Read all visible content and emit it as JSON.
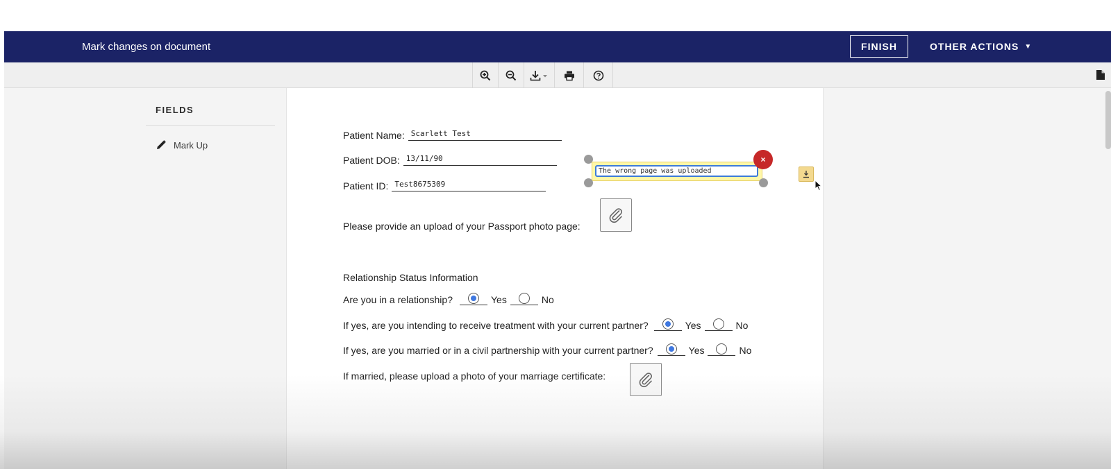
{
  "header": {
    "title": "Mark changes on document",
    "finish_label": "FINISH",
    "other_actions_label": "OTHER ACTIONS",
    "other_actions_caret": "▼"
  },
  "toolbar": {
    "icons": [
      "zoom-in-icon",
      "zoom-out-icon",
      "download-icon",
      "print-icon",
      "help-icon"
    ],
    "right_icon": "document-icon"
  },
  "sidebar": {
    "heading": "FIELDS",
    "items": [
      {
        "label": "Mark Up",
        "icon": "pencil-icon"
      }
    ]
  },
  "document": {
    "patient_name_label": "Patient Name:",
    "patient_name_value": "Scarlett Test",
    "patient_dob_label": "Patient DOB:",
    "patient_dob_value": "13/11/90",
    "patient_id_label": "Patient ID:",
    "patient_id_value": "Test8675309",
    "passport_prompt": "Please provide an upload of your Passport photo page:",
    "relationship_heading": "Relationship Status Information",
    "questions": [
      {
        "text": "Are you in a relationship?",
        "yes": "Yes",
        "no": "No",
        "selected": "yes"
      },
      {
        "text": "If yes, are you intending to receive treatment with your current partner?",
        "yes": "Yes",
        "no": "No",
        "selected": "yes"
      },
      {
        "text": "If yes, are you married or in a civil partnership with your current partner?",
        "yes": "Yes",
        "no": "No",
        "selected": "yes"
      }
    ],
    "marriage_prompt": "If married, please upload a photo of your marriage certificate:"
  },
  "annotation": {
    "text": "The wrong page was uploaded",
    "delete_glyph": "×"
  },
  "colors": {
    "header_bg": "#1b2366",
    "radio_selected": "#3f78e0",
    "annotation_bg": "#fff7a8",
    "delete_red": "#c62828"
  }
}
